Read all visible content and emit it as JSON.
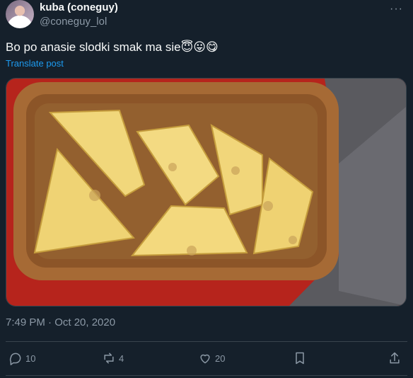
{
  "author": {
    "display_name": "kuba (coneguy)",
    "handle": "@coneguy_lol"
  },
  "tweet": {
    "text": "Bo po anasie slodki smak ma sie",
    "emojis": "😇😛😋",
    "translate_label": "Translate post",
    "image_alt": "Pineapple slices on a wooden tray",
    "timestamp": "7:49 PM · Oct 20, 2020"
  },
  "actions": {
    "replies": "10",
    "retweets": "4",
    "likes": "20"
  },
  "more_label": "···",
  "colors": {
    "background": "#15202b",
    "text_primary": "#f7f9f9",
    "text_secondary": "#8b98a5",
    "link": "#1d9bf0",
    "border": "#38444d"
  }
}
